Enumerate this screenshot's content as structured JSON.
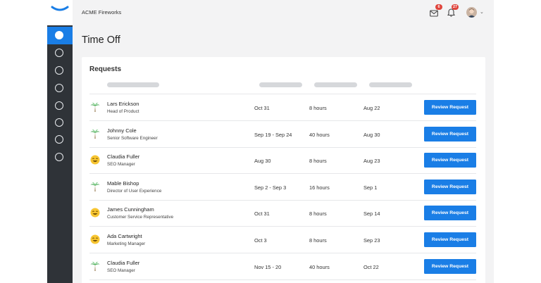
{
  "app": {
    "name": "ACME Fireworks"
  },
  "topbar": {
    "mail_badge": "6",
    "bell_badge": "27"
  },
  "page": {
    "title": "Time Off"
  },
  "requests": {
    "title": "Requests",
    "button_label": "Review Request",
    "rows": [
      {
        "name": "Lars Erickson",
        "role": "Head of Product",
        "dates": "Oct 31",
        "hours": "8 hours",
        "submitted": "Aug 22",
        "icon": "palm-tree-icon"
      },
      {
        "name": "Johnny Cole",
        "role": "Senior Software Engineer",
        "dates": "Sep 19 - Sep 24",
        "hours": "40 hours",
        "submitted": "Aug 30",
        "icon": "palm-tree-icon"
      },
      {
        "name": "Claudia Fuller",
        "role": "SEO Manager",
        "dates": "Aug 30",
        "hours": "8 hours",
        "submitted": "Aug 23",
        "icon": "smiley-icon"
      },
      {
        "name": "Mable Bishop",
        "role": "Director of User Experience",
        "dates": "Sep 2 - Sep 3",
        "hours": "16 hours",
        "submitted": "Sep 1",
        "icon": "palm-tree-icon"
      },
      {
        "name": "James Cunningham",
        "role": "Customer Service Representative",
        "dates": "Oct 31",
        "hours": "8 hours",
        "submitted": "Sep 14",
        "icon": "smiley-icon"
      },
      {
        "name": "Ada Cartwright",
        "role": "Marketing Manager",
        "dates": "Oct 3",
        "hours": "8 hours",
        "submitted": "Sep 23",
        "icon": "smiley-icon"
      },
      {
        "name": "Claudia Fuller",
        "role": "SEO Manager",
        "dates": "Nov 15 - 20",
        "hours": "40 hours",
        "submitted": "Oct 22",
        "icon": "palm-tree-icon"
      }
    ]
  },
  "colors": {
    "accent": "#1a7ee6",
    "rail": "#2f3338",
    "badge": "#e0443b"
  }
}
